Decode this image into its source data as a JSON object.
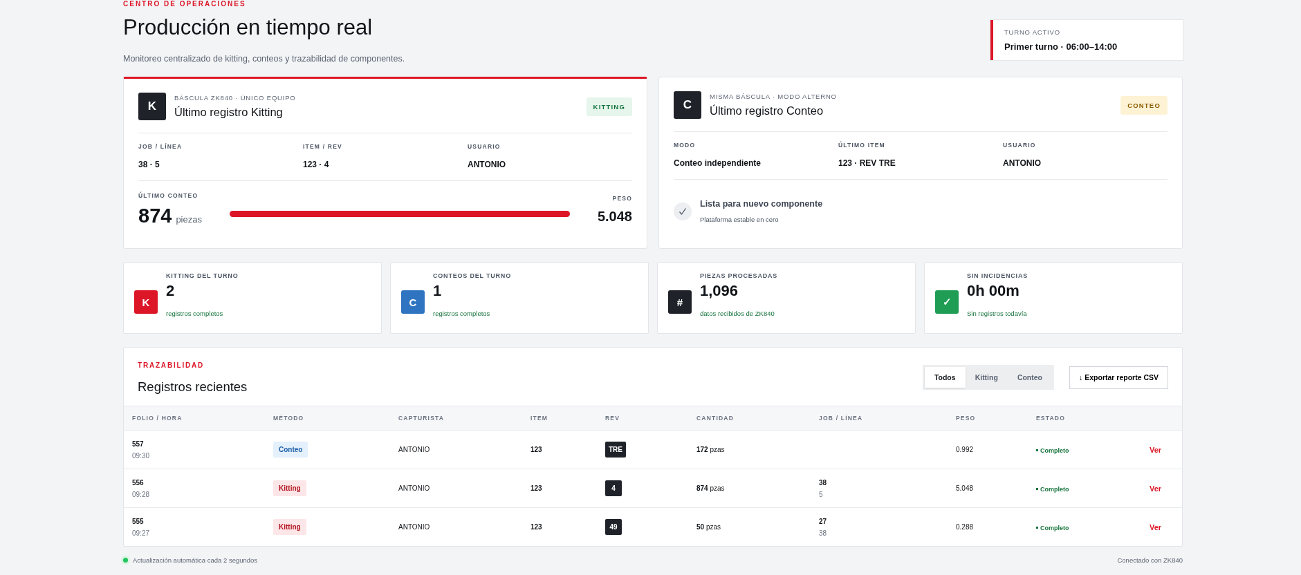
{
  "header": {
    "eyebrow": "CENTRO DE OPERACIONES",
    "title": "Producción en tiempo real",
    "subtitle": "Monitoreo centralizado de kitting, conteos y trazabilidad de componentes.",
    "shift": {
      "label": "TURNO ACTIVO",
      "value": "Primer turno · 06:00–14:00"
    }
  },
  "hero_cards": [
    {
      "kind": "kitting",
      "selected": true,
      "avatar": "K",
      "overline": "BÁSCULA ZK840 · ÚNICO EQUIPO",
      "title": "Último registro Kitting",
      "badge": "KITTING",
      "fields": [
        {
          "label": "JOB / LÍNEA",
          "value": "38 · 5"
        },
        {
          "label": "ITEM / REV",
          "value": "123 · 4"
        },
        {
          "label": "USUARIO",
          "value": "ANTONIO"
        }
      ],
      "count_label": "ÚLTIMO CONTEO",
      "count": "874",
      "unit": "piezas",
      "level": 1,
      "weight_label": "PESO",
      "weight": "5.048"
    },
    {
      "kind": "conteo",
      "selected": false,
      "avatar": "C",
      "overline": "MISMA BÁSCULA · MODO ALTERNO",
      "title": "Último registro Conteo",
      "badge": "CONTEO",
      "fields": [
        {
          "label": "MODO",
          "value": "Conteo independiente"
        },
        {
          "label": "ÚLTIMO ITEM",
          "value": "123 · REV TRE"
        },
        {
          "label": "USUARIO",
          "value": "ANTONIO"
        }
      ],
      "status_title": "Lista para nuevo componente",
      "status_note": "Plataforma estable en cero"
    }
  ],
  "stats": [
    {
      "icon": "K",
      "color": "#dc1626",
      "label": "KITTING DEL TURNO",
      "value": "2",
      "note": "registros completos"
    },
    {
      "icon": "C",
      "color": "#2f74c0",
      "label": "CONTEOS DEL TURNO",
      "value": "1",
      "note": "registros completos"
    },
    {
      "icon": "#",
      "color": "#1f2329",
      "label": "PIEZAS PROCESADAS",
      "value": "1,096",
      "note": "datos recibidos de ZK840"
    },
    {
      "icon": "✓",
      "color": "#1f9d55",
      "label": "SIN INCIDENCIAS",
      "value": "0h 00m",
      "note": "Sin registros todavía"
    }
  ],
  "table": {
    "eyebrow": "TRAZABILIDAD",
    "title": "Registros recientes",
    "filters": [
      {
        "label": "Todos",
        "selected": true
      },
      {
        "label": "Kitting",
        "selected": false
      },
      {
        "label": "Conteo",
        "selected": false
      }
    ],
    "export_button": "↓ Exportar reporte CSV",
    "columns": [
      "FOLIO / HORA",
      "MÉTODO",
      "CAPTURISTA",
      "ITEM",
      "REV",
      "CANTIDAD",
      "JOB / LÍNEA",
      "PESO",
      "ESTADO"
    ],
    "rows": [
      {
        "folio": "557",
        "time": "09:30",
        "method": {
          "label": "Conteo",
          "kind": "conteo"
        },
        "user": "ANTONIO",
        "item": "123",
        "rev": "TRE",
        "quantity": "**172** pzas",
        "peso": "0.992",
        "estado": "Completo",
        "action": "Ver"
      },
      {
        "folio": "556",
        "time": "09:28",
        "method": {
          "label": "Kitting",
          "kind": "kitting"
        },
        "user": "ANTONIO",
        "item": "123",
        "rev": "4",
        "quantity": "**874** pzas",
        "job": "38",
        "line": "5",
        "peso": "5.048",
        "estado": "Completo",
        "action": "Ver"
      },
      {
        "folio": "555",
        "time": "09:27",
        "method": {
          "label": "Kitting",
          "kind": "kitting"
        },
        "user": "ANTONIO",
        "item": "123",
        "rev": "49",
        "quantity": "**50** pzas",
        "job": "27",
        "line": "38",
        "peso": "0.288",
        "estado": "Completo",
        "action": "Ver"
      }
    ]
  },
  "footer": {
    "left": "Actualización automática cada 2 segundos",
    "right": "Conectado con ZK840"
  }
}
